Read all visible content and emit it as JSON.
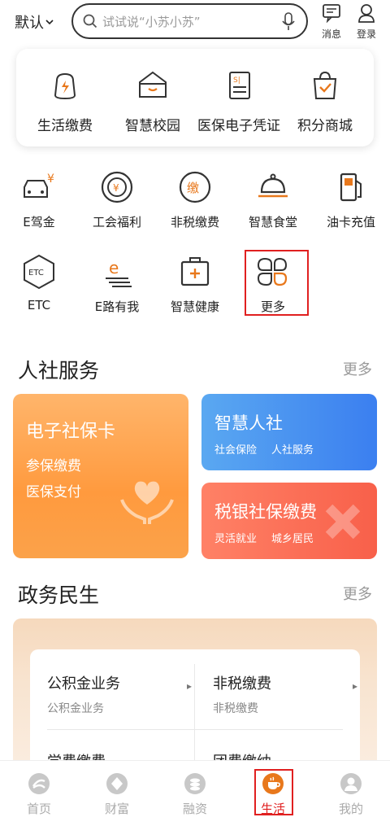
{
  "header": {
    "city": "默认",
    "search_placeholder": "试试说“小苏小苏”",
    "messages_label": "消息",
    "login_label": "登录"
  },
  "top_services": [
    {
      "label": "生活缴费",
      "icon": "lightning-bag-icon"
    },
    {
      "label": "智慧校园",
      "icon": "school-icon"
    },
    {
      "label": "医保电子凭证",
      "icon": "medical-card-icon"
    },
    {
      "label": "积分商城",
      "icon": "shopping-bag-icon"
    }
  ],
  "grid_services": [
    {
      "label": "E驾金",
      "icon": "car-yen-icon"
    },
    {
      "label": "工会福利",
      "icon": "coin-ring-icon"
    },
    {
      "label": "非税缴费",
      "icon": "tax-coin-icon"
    },
    {
      "label": "智慧食堂",
      "icon": "food-cloche-icon"
    },
    {
      "label": "油卡充值",
      "icon": "fuel-pump-icon"
    },
    {
      "label": "ETC",
      "icon": "etc-hexagon-icon"
    },
    {
      "label": "E路有我",
      "icon": "e-road-icon"
    },
    {
      "label": "智慧健康",
      "icon": "medical-kit-icon"
    },
    {
      "label": "更多",
      "icon": "four-petal-icon"
    }
  ],
  "social": {
    "title": "人社服务",
    "more": "更多",
    "card_ecard": {
      "title": "电子社保卡",
      "sub1": "参保缴费",
      "sub2": "医保支付"
    },
    "card_smart": {
      "title": "智慧人社",
      "sub1": "社会保险",
      "sub2": "人社服务"
    },
    "card_tax": {
      "title": "税银社保缴费",
      "sub1": "灵活就业",
      "sub2": "城乡居民"
    }
  },
  "gov": {
    "title": "政务民生",
    "more": "更多",
    "items": [
      {
        "title": "公积金业务",
        "sub": "公积金业务"
      },
      {
        "title": "非税缴费",
        "sub": "非税缴费"
      },
      {
        "title": "学费缴费",
        "sub": ""
      },
      {
        "title": "团费缴纳",
        "sub": ""
      }
    ]
  },
  "tabs": [
    {
      "label": "首页",
      "icon": "home-logo-icon"
    },
    {
      "label": "财富",
      "icon": "wealth-icon"
    },
    {
      "label": "融资",
      "icon": "loan-coins-icon"
    },
    {
      "label": "生活",
      "icon": "coffee-cup-icon",
      "active": true
    },
    {
      "label": "我的",
      "icon": "user-icon"
    }
  ],
  "colors": {
    "accent": "#e8781c",
    "highlight": "#e02020",
    "orange_card": "#ff9a3e",
    "blue_card": "#3b7ff0",
    "red_card": "#f8604a"
  }
}
